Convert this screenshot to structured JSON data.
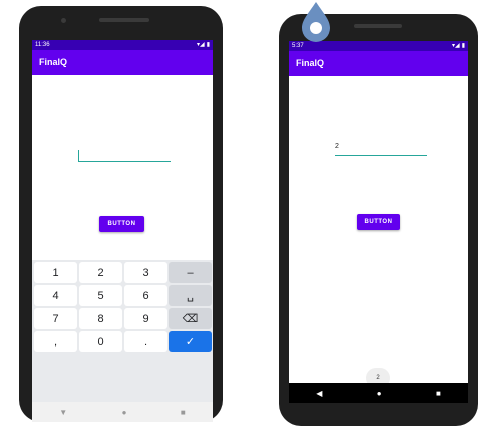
{
  "left_phone": {
    "status_time": "11:36",
    "app_title": "FinalQ",
    "text_field_value": "",
    "button_label": "BUTTON",
    "keypad_rows": [
      [
        "1",
        "2",
        "3",
        "–"
      ],
      [
        "4",
        "5",
        "6",
        "␣"
      ],
      [
        "7",
        "8",
        "9",
        "⌫"
      ],
      [
        ",",
        "0",
        ".",
        "✓"
      ]
    ]
  },
  "right_phone": {
    "status_time": "5:37",
    "app_title": "FinalQ",
    "text_field_value": "2",
    "button_label": "BUTTON",
    "number_chip": "2"
  },
  "colors": {
    "app_bar": "#6200ee",
    "status_bar": "#3700b3",
    "field_underline": "#26a69a",
    "marker": "#6a8fc0"
  },
  "icons": [
    "signal-icon",
    "battery-icon",
    "backspace-icon",
    "check-icon",
    "location-pin-icon"
  ]
}
